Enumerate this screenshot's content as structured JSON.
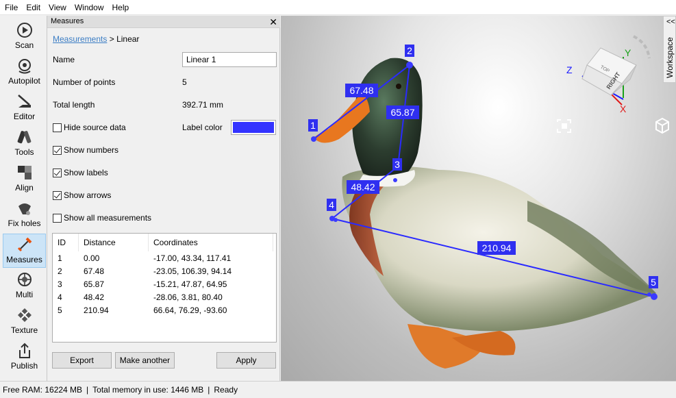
{
  "menu": [
    "File",
    "Edit",
    "View",
    "Window",
    "Help"
  ],
  "tools": [
    {
      "label": "Scan",
      "icon": "scan-icon"
    },
    {
      "label": "Autopilot",
      "icon": "autopilot-icon"
    },
    {
      "label": "Editor",
      "icon": "editor-icon"
    },
    {
      "label": "Tools",
      "icon": "tools-icon"
    },
    {
      "label": "Align",
      "icon": "align-icon"
    },
    {
      "label": "Fix holes",
      "icon": "fix-holes-icon"
    },
    {
      "label": "Measures",
      "icon": "measures-icon",
      "active": true
    },
    {
      "label": "Multi",
      "icon": "multi-icon"
    },
    {
      "label": "Texture",
      "icon": "texture-icon"
    },
    {
      "label": "Publish",
      "icon": "publish-icon"
    }
  ],
  "panel": {
    "title": "Measures",
    "close": "✕",
    "breadcrumb": {
      "link": "Measurements",
      "separator": " > ",
      "current": "Linear"
    },
    "name_label": "Name",
    "name_value": "Linear 1",
    "points_label": "Number of points",
    "points_value": "5",
    "length_label": "Total length",
    "length_value": "392.71 mm",
    "hide_source": {
      "label": "Hide source data",
      "checked": false
    },
    "label_color_label": "Label color",
    "label_color": "#3333ff",
    "show_numbers": {
      "label": "Show numbers",
      "checked": true
    },
    "show_labels": {
      "label": "Show labels",
      "checked": true
    },
    "show_arrows": {
      "label": "Show arrows",
      "checked": true
    },
    "show_all": {
      "label": "Show all measurements",
      "checked": false
    },
    "table": {
      "headers": [
        "ID",
        "Distance",
        "Coordinates"
      ],
      "rows": [
        [
          "1",
          "0.00",
          "-17.00, 43.34, 117.41"
        ],
        [
          "2",
          "67.48",
          "-23.05, 106.39, 94.14"
        ],
        [
          "3",
          "65.87",
          "-15.21, 47.87, 64.95"
        ],
        [
          "4",
          "48.42",
          "-28.06, 3.81, 80.40"
        ],
        [
          "5",
          "210.94",
          "66.64, 76.29, -93.60"
        ]
      ]
    },
    "buttons": {
      "export": "Export",
      "make_another": "Make another",
      "apply": "Apply"
    }
  },
  "viewport": {
    "points": [
      "1",
      "2",
      "3",
      "4",
      "5"
    ],
    "segments": [
      "67.48",
      "65.87",
      "48.42",
      "210.94"
    ],
    "axes": {
      "x": "X",
      "y": "Y",
      "z": "Z"
    },
    "cube_faces": {
      "top": "TOP",
      "right": "RIGHT"
    },
    "workspace_tab": "Workspace",
    "collapse": "<<",
    "accent_color": "#3333ff"
  },
  "status": {
    "free_ram": "Free RAM: 16224 MB",
    "memory": "Total memory in use: 1446 MB",
    "state": "Ready"
  }
}
